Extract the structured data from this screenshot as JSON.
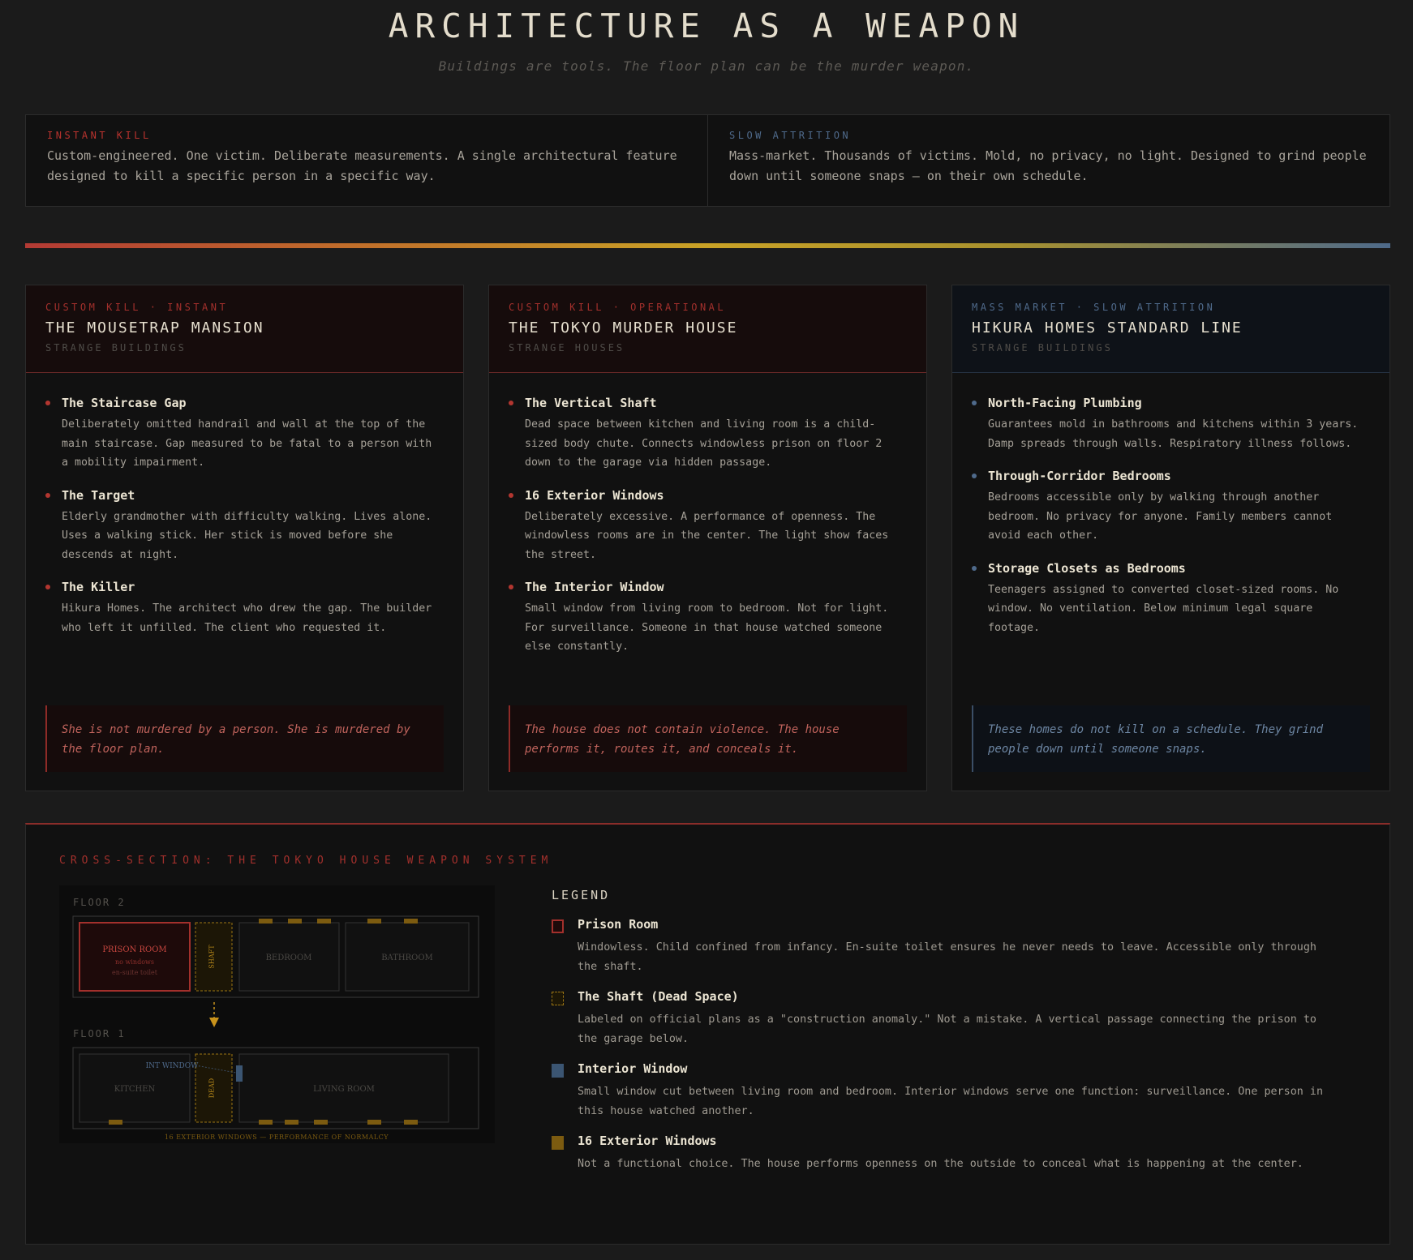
{
  "header": {
    "title": "ARCHITECTURE AS A WEAPON",
    "subtitle": "Buildings are tools. The floor plan can be the murder weapon."
  },
  "modes": [
    {
      "tag": "INSTANT KILL",
      "text": "Custom-engineered. One victim. Deliberate measurements. A single architectural feature designed to kill a specific person in a specific way.",
      "color": "#b9332e"
    },
    {
      "tag": "SLOW ATTRITION",
      "text": "Mass-market. Thousands of victims. Mold, no privacy, no light. Designed to grind people down until someone snaps — on their own schedule.",
      "color": "#4f6a8b"
    }
  ],
  "cards": [
    {
      "tag": "CUSTOM KILL · INSTANT",
      "title": "THE MOUSETRAP MANSION",
      "subtitle": "STRANGE BUILDINGS",
      "accent": "#b33630",
      "head_bg": "#160c0c",
      "items": [
        {
          "title": "The Staircase Gap",
          "text": "Deliberately omitted handrail and wall at the top of the main staircase. Gap measured to be fatal to a person with a mobility impairment."
        },
        {
          "title": "The Target",
          "text": "Elderly grandmother with difficulty walking. Lives alone. Uses a walking stick. Her stick is moved before she descends at night."
        },
        {
          "title": "The Killer",
          "text": "Hikura Homes. The architect who drew the gap. The builder who left it unfilled. The client who requested it."
        }
      ],
      "quote": "She is not murdered by a person. She is murdered by the floor plan."
    },
    {
      "tag": "CUSTOM KILL · OPERATIONAL",
      "title": "THE TOKYO MURDER HOUSE",
      "subtitle": "STRANGE HOUSES",
      "accent": "#b33630",
      "head_bg": "#160c0c",
      "items": [
        {
          "title": "The Vertical Shaft",
          "text": "Dead space between kitchen and living room is a child-sized body chute. Connects windowless prison on floor 2 down to the garage via hidden passage."
        },
        {
          "title": "16 Exterior Windows",
          "text": "Deliberately excessive. A performance of openness. The windowless rooms are in the center. The light show faces the street."
        },
        {
          "title": "The Interior Window",
          "text": "Small window from living room to bedroom. Not for light. For surveillance. Someone in that house watched someone else constantly."
        }
      ],
      "quote": "The house does not contain violence. The house performs it, routes it, and conceals it."
    },
    {
      "tag": "MASS MARKET · SLOW ATTRITION",
      "title": "HIKURA HOMES STANDARD LINE",
      "subtitle": "STRANGE BUILDINGS",
      "accent": "#4f6a8b",
      "head_bg": "#0e1218",
      "items": [
        {
          "title": "North-Facing Plumbing",
          "text": "Guarantees mold in bathrooms and kitchens within 3 years. Damp spreads through walls. Respiratory illness follows."
        },
        {
          "title": "Through-Corridor Bedrooms",
          "text": "Bedrooms accessible only by walking through another bedroom. No privacy for anyone. Family members cannot avoid each other."
        },
        {
          "title": "Storage Closets as Bedrooms",
          "text": "Teenagers assigned to converted closet-sized rooms. No window. No ventilation. Below minimum legal square footage."
        }
      ],
      "quote": "These homes do not kill on a schedule. They grind people down until someone snaps."
    }
  ],
  "cross_section": {
    "tag": "CROSS-SECTION: THE TOKYO HOUSE WEAPON SYSTEM",
    "diagram": {
      "floor2_label": "FLOOR 2",
      "floor1_label": "FLOOR 1",
      "prison_room": "PRISON ROOM",
      "prison_note1": "no windows",
      "prison_note2": "en-suite toilet",
      "shaft": "SHAFT",
      "bedroom": "BEDROOM",
      "bathroom": "BATHROOM",
      "kitchen": "KITCHEN",
      "dead": "DEAD",
      "int_window": "INT WINDOW",
      "living_room": "LIVING ROOM",
      "windows_caption": "16 EXTERIOR WINDOWS — PERFORMANCE OF NORMALCY"
    },
    "legend": {
      "title": "LEGEND",
      "items": [
        {
          "name": "Prison Room",
          "text": "Windowless. Child confined from infancy. En-suite toilet ensures he never needs to leave. Accessible only through the shaft.",
          "swatch": "prison"
        },
        {
          "name": "The Shaft (Dead Space)",
          "text": "Labeled on official plans as a \"construction anomaly.\" Not a mistake. A vertical passage connecting the prison to the garage below.",
          "swatch": "shaft"
        },
        {
          "name": "Interior Window",
          "text": "Small window cut between living room and bedroom. Interior windows serve one function: surveillance. One person in this house watched another.",
          "swatch": "interior"
        },
        {
          "name": "16 Exterior Windows",
          "text": "Not a functional choice. The house performs openness on the outside to conceal what is happening at the center.",
          "swatch": "exterior"
        }
      ]
    }
  }
}
